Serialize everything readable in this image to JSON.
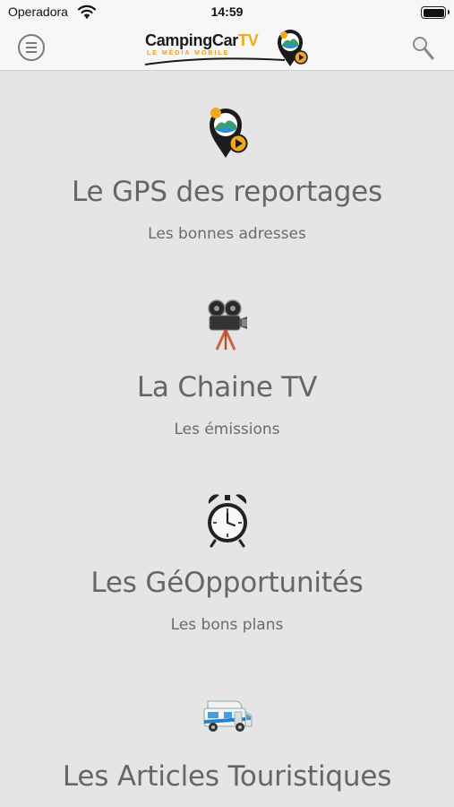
{
  "status_bar": {
    "carrier": "Operadora",
    "time": "14:59"
  },
  "header": {
    "logo_main": "CampingCar",
    "logo_tv": "TV",
    "logo_tagline": "LE MÉDIA MOBILE",
    "menu_icon": "menu-icon",
    "search_icon": "search-icon"
  },
  "sections": [
    {
      "icon": "map-pin-video-icon",
      "title": "Le GPS des reportages",
      "subtitle": "Les bonnes adresses"
    },
    {
      "icon": "movie-camera-icon",
      "title": "La Chaine TV",
      "subtitle": "Les émissions"
    },
    {
      "icon": "alarm-clock-icon",
      "title": "Les GéOpportunités",
      "subtitle": "Les bons plans"
    },
    {
      "icon": "camper-van-icon",
      "title": "Les Articles Touristiques",
      "subtitle": ""
    }
  ],
  "colors": {
    "background": "#e5e5e5",
    "bar": "#f7f7f7",
    "text": "#666666",
    "accent": "#f0a81c"
  }
}
